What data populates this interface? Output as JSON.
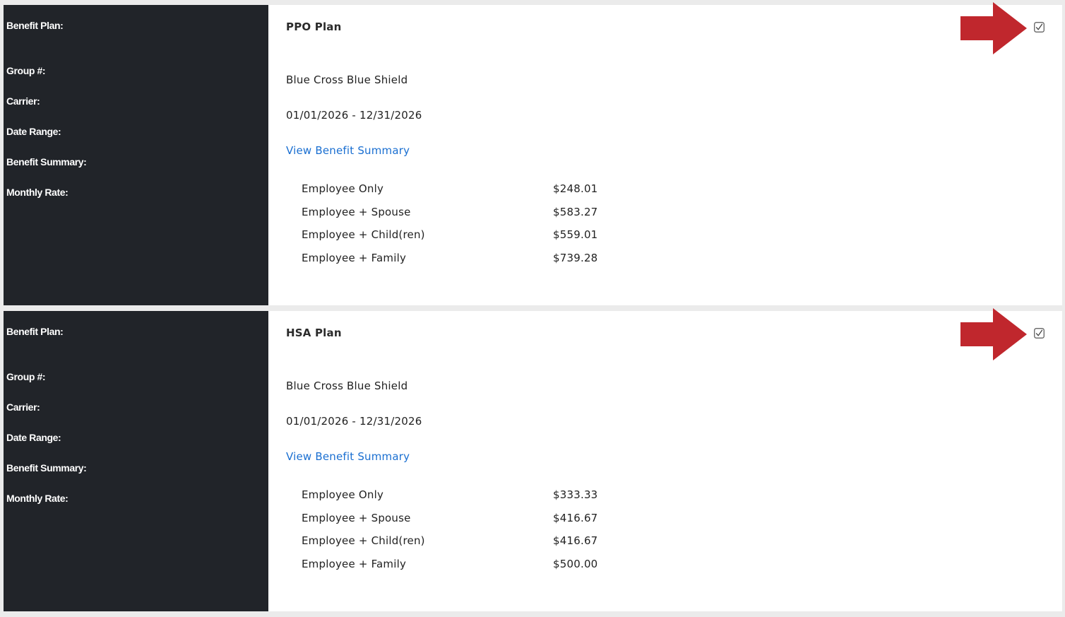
{
  "labels": {
    "benefit_plan": "Benefit Plan:",
    "group": "Group #:",
    "carrier": "Carrier:",
    "date_range": "Date Range:",
    "benefit_summary": "Benefit Summary:",
    "monthly_rate": "Monthly Rate:"
  },
  "plans": [
    {
      "name": "PPO Plan",
      "carrier": "Blue Cross Blue Shield",
      "date_range": "01/01/2026 - 12/31/2026",
      "summary_link": "View Benefit Summary",
      "checked": true,
      "rates": [
        {
          "tier": "Employee Only",
          "amount": "$248.01"
        },
        {
          "tier": "Employee + Spouse",
          "amount": "$583.27"
        },
        {
          "tier": "Employee + Child(ren)",
          "amount": "$559.01"
        },
        {
          "tier": "Employee + Family",
          "amount": "$739.28"
        }
      ]
    },
    {
      "name": "HSA Plan",
      "carrier": "Blue Cross Blue Shield",
      "date_range": "01/01/2026 - 12/31/2026",
      "summary_link": "View Benefit Summary",
      "checked": true,
      "rates": [
        {
          "tier": "Employee Only",
          "amount": "$333.33"
        },
        {
          "tier": "Employee + Spouse",
          "amount": "$416.67"
        },
        {
          "tier": "Employee + Child(ren)",
          "amount": "$416.67"
        },
        {
          "tier": "Employee + Family",
          "amount": "$500.00"
        }
      ]
    }
  ],
  "colors": {
    "label_panel": "#212429",
    "link": "#1a6fd1",
    "arrow": "#c0272d",
    "page_background": "#ebebeb"
  }
}
